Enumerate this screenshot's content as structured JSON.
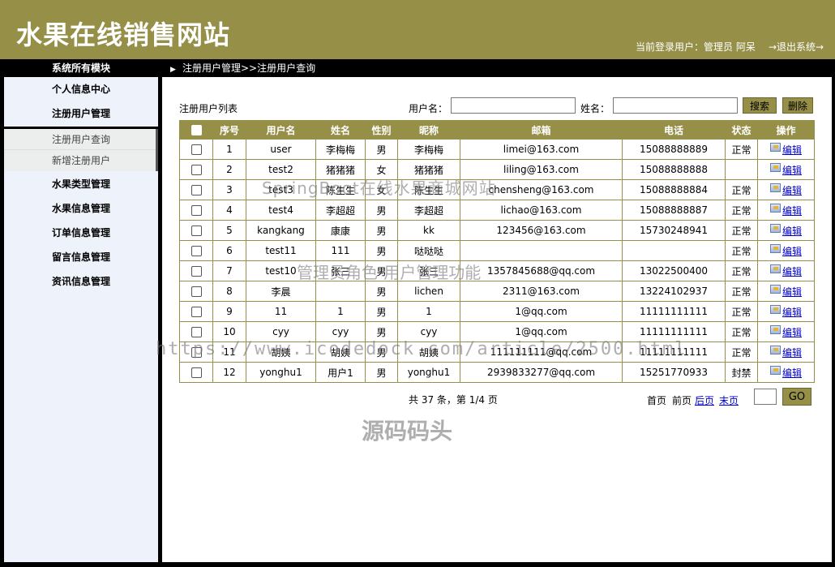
{
  "header": {
    "site_title": "水果在线销售网站",
    "user_info": "当前登录用户：管理员 阿呆",
    "logout": "→退出系统→"
  },
  "sidebar": {
    "heading": "系统所有模块",
    "items": [
      {
        "label": "个人信息中心"
      },
      {
        "label": "注册用户管理"
      },
      {
        "label": "水果类型管理"
      },
      {
        "label": "水果信息管理"
      },
      {
        "label": "订单信息管理"
      },
      {
        "label": "留言信息管理"
      },
      {
        "label": "资讯信息管理"
      }
    ],
    "sub_items": [
      {
        "label": "注册用户查询",
        "active": true
      },
      {
        "label": "新增注册用户",
        "active": false
      }
    ]
  },
  "breadcrumb": "注册用户管理>>注册用户查询",
  "main": {
    "list_title": "注册用户列表",
    "search": {
      "username_label": "用户名：",
      "username_value": "",
      "name_label": "姓名：",
      "name_value": "",
      "search_button": "搜索",
      "delete_button": "删除"
    },
    "table": {
      "columns": [
        "序号",
        "用户名",
        "姓名",
        "性别",
        "昵称",
        "邮箱",
        "电话",
        "状态",
        "操作"
      ],
      "edit_label": "编辑",
      "rows": [
        [
          "1",
          "user",
          "李梅梅",
          "男",
          "李梅梅",
          "limei@163.com",
          "15088888889",
          "正常"
        ],
        [
          "2",
          "test2",
          "猪猪猪",
          "女",
          "猪猪猪",
          "liling@163.com",
          "15088888888",
          ""
        ],
        [
          "3",
          "test3",
          "陈生生",
          "女",
          "陈生生",
          "chensheng@163.com",
          "15088888884",
          "正常"
        ],
        [
          "4",
          "test4",
          "李超超",
          "男",
          "李超超",
          "lichao@163.com",
          "15088888887",
          "正常"
        ],
        [
          "5",
          "kangkang",
          "康康",
          "男",
          "kk",
          "123456@163.com",
          "15730248941",
          "正常"
        ],
        [
          "6",
          "test11",
          "111",
          "男",
          "哒哒哒",
          "",
          "",
          "正常"
        ],
        [
          "7",
          "test10",
          "张三",
          "男",
          "张三",
          "1357845688@qq.com",
          "13022500400",
          "正常"
        ],
        [
          "8",
          "李晨",
          "",
          "男",
          "lichen",
          "2311@163.com",
          "13224102937",
          "正常"
        ],
        [
          "9",
          "11",
          "1",
          "男",
          "1",
          "1@qq.com",
          "11111111111",
          "正常"
        ],
        [
          "10",
          "cyy",
          "cyy",
          "男",
          "cyy",
          "1@qq.com",
          "11111111111",
          "正常"
        ],
        [
          "11",
          "胡姨",
          "胡姨",
          "男",
          "胡姨",
          "111111111@qq.com",
          "11111111111",
          "正常"
        ],
        [
          "12",
          "yonghu1",
          "用户1",
          "男",
          "yonghu1",
          "2939833277@qq.com",
          "15251770933",
          "封禁"
        ]
      ]
    },
    "pager": {
      "summary": "共 37 条，第 1/4 页",
      "first": "首页",
      "prev": "前页",
      "next": "后页",
      "last": "末页",
      "page_value": "",
      "go": "GO"
    }
  },
  "watermarks": {
    "line1": "SpringBoot在线水果商城网站",
    "line2": "管理员角色-用户管理功能",
    "line3": "https://www.icodedock.com/article/2500.html",
    "line4": "源码码头"
  },
  "colors": {
    "brand_olive": "#958f48",
    "sidebar_bg": "#eef2fb",
    "link_blue": "#0000cc"
  }
}
